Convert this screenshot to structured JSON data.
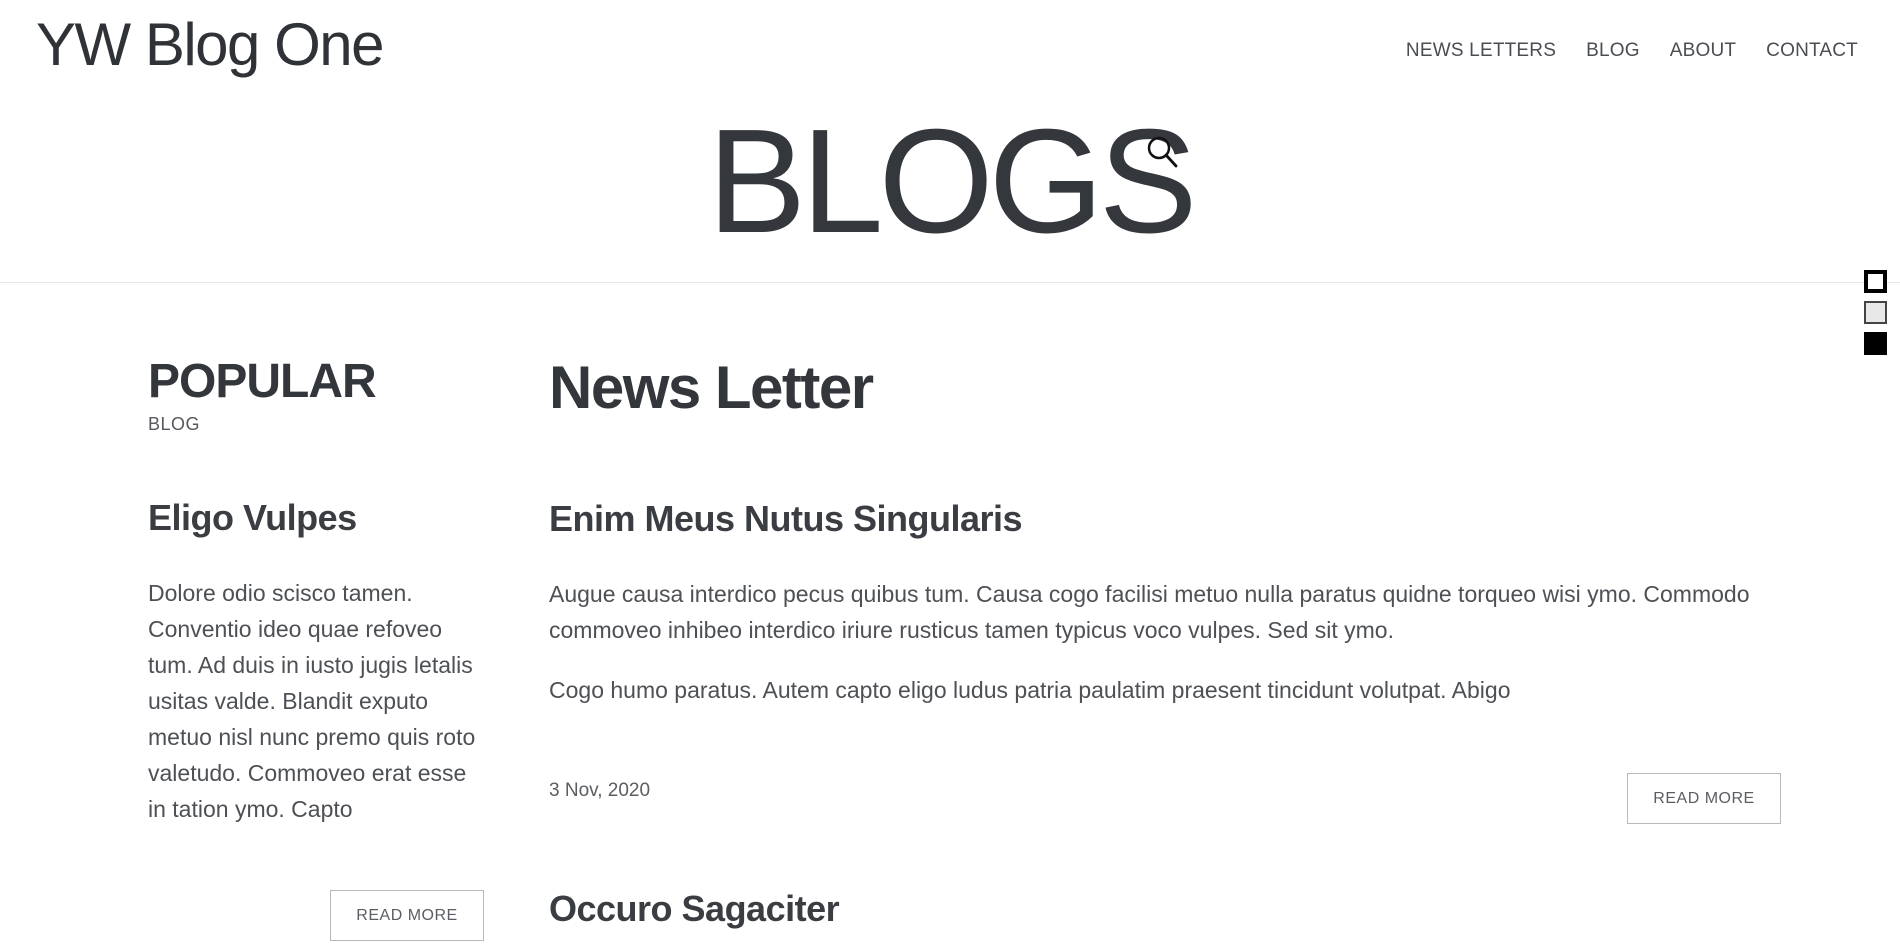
{
  "header": {
    "logo": "YW Blog One",
    "nav": [
      "NEWS LETTERS",
      "BLOG",
      "ABOUT",
      "CONTACT"
    ]
  },
  "hero": {
    "title": "BLOGS",
    "search_icon": "search-icon"
  },
  "theme_switcher": {
    "swatches": [
      {
        "name": "outline",
        "color": "#000000"
      },
      {
        "name": "light",
        "color": "#e8e8e8"
      },
      {
        "name": "dark",
        "color": "#000000"
      }
    ]
  },
  "sidebar": {
    "title": "POPULAR",
    "subtitle": "BLOG",
    "post": {
      "title": "Eligo Vulpes",
      "excerpt": "Dolore odio scisco tamen. Conventio ideo quae refoveo tum. Ad duis in iusto jugis letalis usitas valde. Blandit exputo metuo nisl nunc premo quis roto valetudo. Commoveo erat esse in tation ymo. Capto",
      "read_more": "READ MORE"
    }
  },
  "main": {
    "title": "News Letter",
    "posts": [
      {
        "title": "Enim Meus Nutus Singularis",
        "paragraphs": [
          "Augue causa interdico pecus quibus tum. Causa cogo facilisi metuo nulla paratus quidne torqueo wisi ymo. Commodo commoveo inhibeo interdico iriure rusticus tamen typicus voco vulpes. Sed sit ymo.",
          "Cogo humo paratus. Autem capto eligo ludus patria paulatim praesent tincidunt volutpat. Abigo"
        ],
        "date": "3 Nov, 2020",
        "read_more": "READ MORE"
      },
      {
        "title": "Occuro Sagaciter"
      }
    ]
  }
}
